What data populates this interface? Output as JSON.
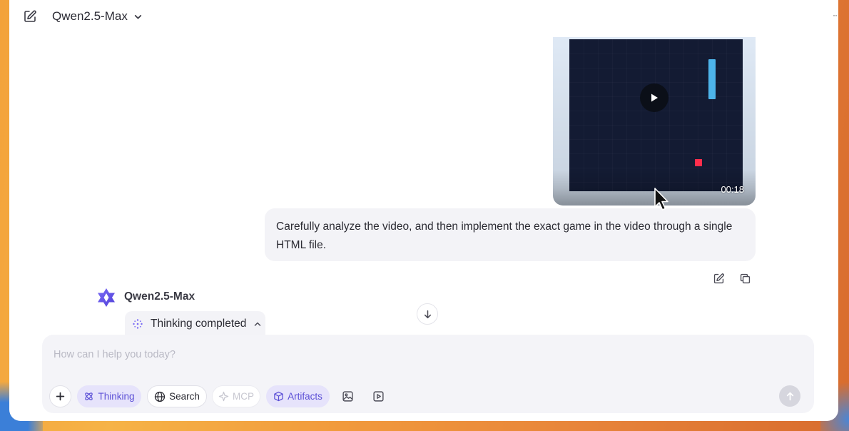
{
  "header": {
    "model_name": "Qwen2.5-Max",
    "edit_icon": "new-chat-edit-icon",
    "dropdown_icon": "chevron-down-icon",
    "more_label": "··"
  },
  "video": {
    "duration": "00:18",
    "play_icon": "play-icon",
    "colors": {
      "background": "#131b33",
      "paddle": "#4db4ea",
      "ball": "#ff2e4c"
    }
  },
  "user_message": {
    "text": "Carefully analyze the video, and then implement the exact game in the video through a single HTML file.",
    "actions": [
      "edit-icon",
      "copy-icon"
    ]
  },
  "assistant": {
    "name": "Qwen2.5-Max",
    "logo_icon": "qwen-logo-icon",
    "thinking_label": "Thinking completed"
  },
  "composer": {
    "placeholder": "How can I help you today?",
    "tools": {
      "thinking": "Thinking",
      "search": "Search",
      "mcp": "MCP",
      "artifacts": "Artifacts"
    },
    "accent_color": "#5b4fd6"
  }
}
